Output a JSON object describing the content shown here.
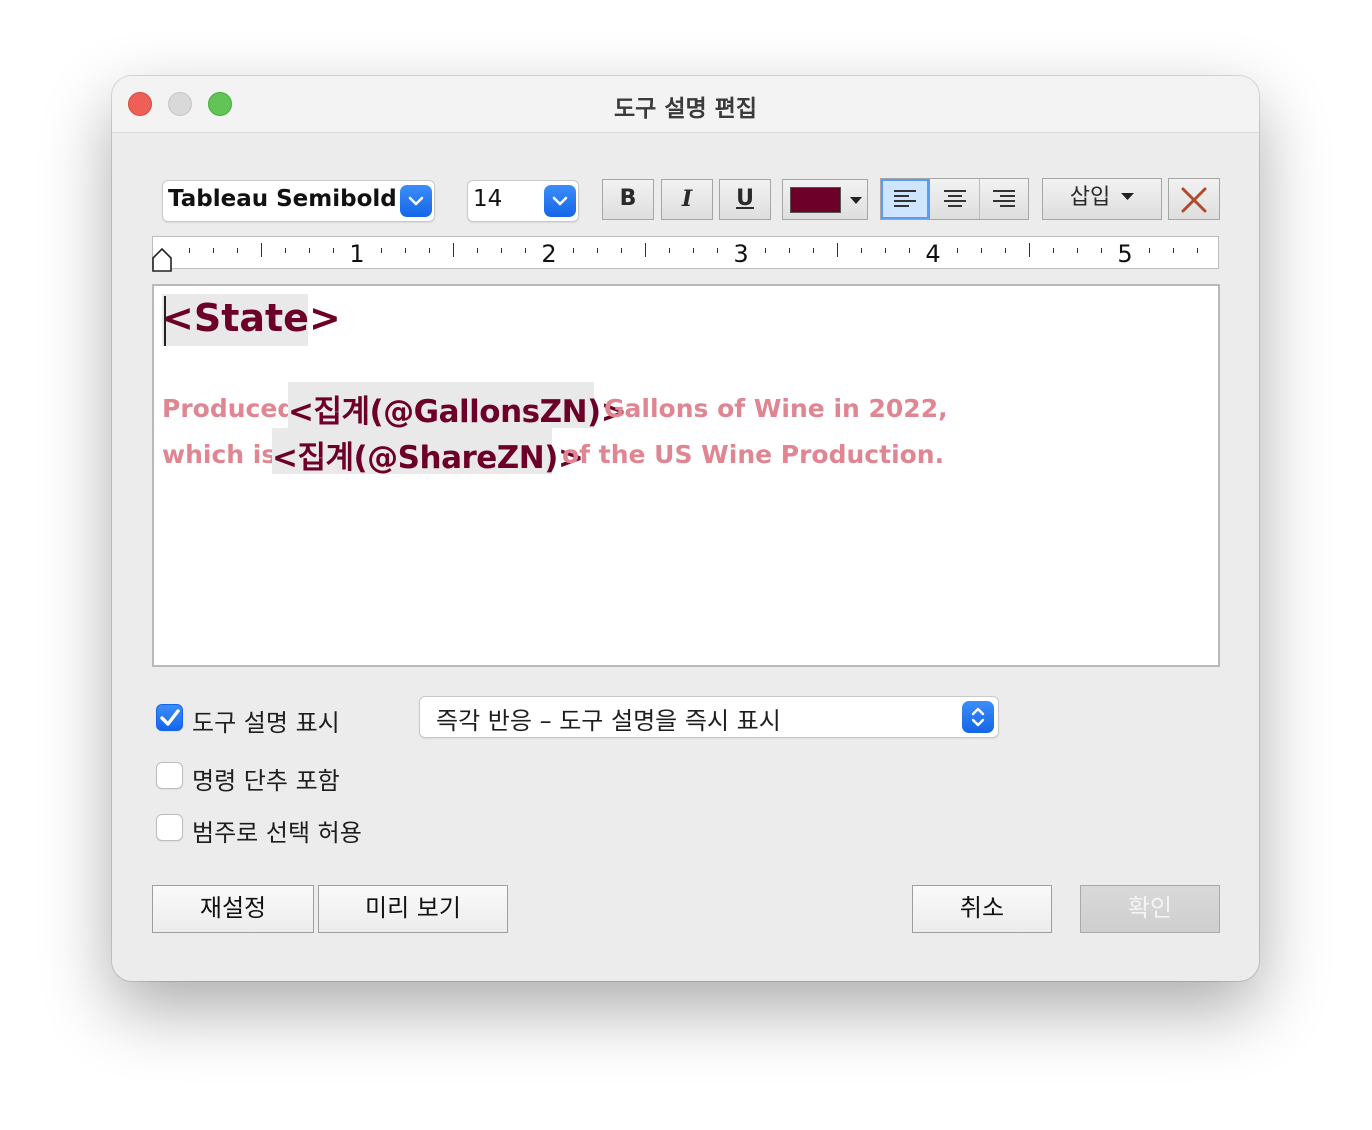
{
  "window": {
    "title": "도구 설명 편집"
  },
  "toolbar": {
    "font_family": "Tableau Semibold",
    "font_size": "14",
    "bold_label": "B",
    "italic_label": "I",
    "underline_label": "U",
    "text_color": "#6d0028",
    "alignment_selected": "left",
    "insert_label": "삽입"
  },
  "ruler": {
    "labels": [
      "1",
      "2",
      "3",
      "4",
      "5"
    ]
  },
  "editor": {
    "line1_field": "<State>",
    "line2_prefix": "Produced",
    "line2_field": "<집계(@GallonsZN)>",
    "line2_suffix": "Gallons of Wine in 2022,",
    "line3_prefix": "which is",
    "line3_field": "<집계(@ShareZN)>",
    "line3_suffix": "of the US Wine Production.",
    "field_color": "#6d0028",
    "text_color": "#e08592"
  },
  "options": {
    "show_tooltip": {
      "label": "도구 설명 표시",
      "checked": true
    },
    "tooltip_mode": "즉각 반응 – 도구 설명을 즉시 표시",
    "include_command_buttons": {
      "label": "명령 단추 포함",
      "checked": false
    },
    "allow_legend_selection": {
      "label": "범주로 선택 허용",
      "checked": false
    }
  },
  "buttons": {
    "reset": "재설정",
    "preview": "미리 보기",
    "cancel": "취소",
    "ok": "확인"
  }
}
